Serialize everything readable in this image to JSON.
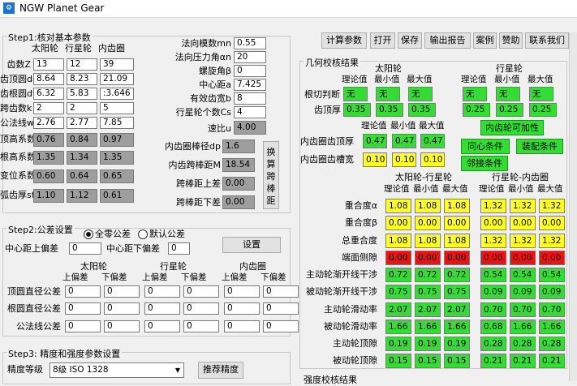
{
  "window": {
    "title": "NGW Planet Gear"
  },
  "step1": {
    "title": "Step1:核对基本参数",
    "col_headers": [
      "太阳轮",
      "行星轮",
      "内齿圈"
    ],
    "rows": [
      {
        "label": "齿数Z",
        "values": [
          "13",
          "12",
          "39"
        ],
        "readonly": false
      },
      {
        "label": "齿顶圆da",
        "values": [
          "8.64",
          "8.23",
          "21.09"
        ],
        "readonly": false
      },
      {
        "label": "齿根圆df",
        "values": [
          "6.32",
          "5.83",
          ":3.646"
        ],
        "readonly": false
      },
      {
        "label": "跨齿数k",
        "values": [
          "2",
          "2",
          "5"
        ],
        "readonly": false
      },
      {
        "label": "公法线wk",
        "values": [
          "2.76",
          "2.77",
          "7.85"
        ],
        "readonly": false
      },
      {
        "label": "顶高系数ha*",
        "values": [
          "0.76",
          "0.84",
          "0.97"
        ],
        "readonly": true
      },
      {
        "label": "根高系数hf*",
        "values": [
          "1.35",
          "1.34",
          "1.35"
        ],
        "readonly": true
      },
      {
        "label": "变位系数x",
        "values": [
          "0.60",
          "0.64",
          "0.65"
        ],
        "readonly": true
      },
      {
        "label": "弧齿厚st",
        "values": [
          "1.10",
          "1.12",
          "0.61"
        ],
        "readonly": true
      }
    ],
    "right_params": [
      {
        "label": "法向模数mn",
        "value": "0.55"
      },
      {
        "label": "法向压力角αn",
        "value": "20"
      },
      {
        "label": "螺旋角β",
        "value": "0"
      },
      {
        "label": "中心距a",
        "value": "7.425"
      },
      {
        "label": "有效齿宽b",
        "value": "8"
      },
      {
        "label": "行星轮个数Cs",
        "value": "4"
      }
    ],
    "speed_ratio": {
      "label": "速比u",
      "value": "4.00"
    },
    "pin_params": [
      {
        "label": "内齿圈棒径dp",
        "value": "1.6"
      },
      {
        "label": "内齿跨棒距M",
        "value": "18.54"
      },
      {
        "label": "跨棒距上差",
        "value": "0.00"
      },
      {
        "label": "跨棒距下差",
        "value": "0.00"
      }
    ],
    "convert_button": [
      "换",
      "算",
      "跨",
      "棒",
      "距"
    ]
  },
  "step2": {
    "title": "Step2:公差设置",
    "radio_zero": "全零公差",
    "radio_default": "默认公差",
    "center_upper_label": "中心距上偏差",
    "center_upper_value": "0",
    "center_lower_label": "中心距下偏差",
    "center_lower_value": "0",
    "set_button": "设置",
    "group_headers": [
      "太阳轮",
      "行星轮",
      "内齿圈"
    ],
    "sub_headers": [
      "上偏差",
      "下偏差"
    ],
    "rows": [
      {
        "label": "顶圆直径公差",
        "values": [
          "0",
          "0",
          "0",
          "0",
          "0",
          "0"
        ]
      },
      {
        "label": "根圆直径公差",
        "values": [
          "0",
          "0",
          "0",
          "0",
          "0",
          "0"
        ]
      },
      {
        "label": "公法线公差",
        "values": [
          "0",
          "0",
          "0",
          "0",
          "0",
          "0"
        ]
      }
    ]
  },
  "step3": {
    "title": "Step3: 精度和强度参数设置",
    "grade_label": "精度等级",
    "grade_value": "8级 ISO 1328",
    "recommend_button": "推荐精度"
  },
  "toolbar": {
    "buttons": [
      "计算参数",
      "打开",
      "保存",
      "输出报告",
      "案例",
      "赞助",
      "联系我们"
    ]
  },
  "geo": {
    "title": "几何校核结果",
    "sun_label": "太阳轮",
    "planet_label": "行星轮",
    "sub_headers": [
      "理论值",
      "最小值",
      "最大值"
    ],
    "undercut_label": "根切判断",
    "undercut_sun": [
      "无",
      "无",
      "无"
    ],
    "undercut_planet": [
      "无",
      "无",
      "无"
    ],
    "tip_label": "齿顶厚",
    "tip_sun": [
      "0.35",
      "0.35",
      "0.35"
    ],
    "tip_planet": [
      "0.25",
      "0.25",
      "0.25"
    ],
    "ring_tip_label": "内齿圈齿顶厚",
    "ring_tip": [
      "0.47",
      "0.47",
      "0.47"
    ],
    "ring_slot_label": "内齿圈齿槽宽",
    "ring_slot": [
      "0.10",
      "0.10",
      "0.10"
    ],
    "ring_feasible_button": "内齿轮可加性",
    "concentric_button": "同心条件",
    "assembly_button": "装配条件",
    "adjacent_button": "邻接条件",
    "mesh_headers": [
      "太阳轮-行星轮",
      "行星轮-内齿圈"
    ],
    "mesh_rows": [
      {
        "label": "重合度α",
        "sp": [
          "1.08",
          "1.08",
          "1.08"
        ],
        "pr": [
          "1.32",
          "1.32",
          "1.32"
        ],
        "color": "y"
      },
      {
        "label": "重合度β",
        "sp": [
          "0.00",
          "0.00",
          "0.00"
        ],
        "pr": [
          "0.00",
          "0.00",
          "0.00"
        ],
        "color": "y"
      },
      {
        "label": "总重合度",
        "sp": [
          "1.08",
          "1.08",
          "1.08"
        ],
        "pr": [
          "1.32",
          "1.32",
          "1.32"
        ],
        "color": "y"
      },
      {
        "label": "端面侧隙",
        "sp": [
          "0.00",
          "0.00",
          "0.00"
        ],
        "pr": [
          "0.00",
          "0.00",
          "0.00"
        ],
        "color": "r"
      },
      {
        "label": "主动轮渐开线干涉",
        "sp": [
          "0.72",
          "0.72",
          "0.72"
        ],
        "pr": [
          "0.54",
          "0.54",
          "0.54"
        ],
        "color": "g"
      },
      {
        "label": "被动轮渐开线干涉",
        "sp": [
          "0.75",
          "0.75",
          "0.75"
        ],
        "pr": [
          "0.09",
          "0.09",
          "0.09"
        ],
        "color": "g"
      },
      {
        "label": "主动轮滑动率",
        "sp": [
          "2.07",
          "2.07",
          "2.07"
        ],
        "pr": [
          "0.70",
          "0.70",
          "0.70"
        ],
        "color": "g"
      },
      {
        "label": "被动轮滑动率",
        "sp": [
          "1.66",
          "1.66",
          "1.66"
        ],
        "pr": [
          "0.68",
          "1.66",
          "1.66"
        ],
        "color": "g"
      },
      {
        "label": "主动轮顶隙",
        "sp": [
          "0.19",
          "0.19",
          "0.19"
        ],
        "pr": [
          "0.28",
          "0.28",
          "0.28"
        ],
        "color": "g"
      },
      {
        "label": "被动轮顶隙",
        "sp": [
          "0.15",
          "0.15",
          "0.15"
        ],
        "pr": [
          "0.21",
          "0.21",
          "0.21"
        ],
        "color": "g"
      }
    ]
  },
  "strength": {
    "title": "强度校核结果"
  }
}
